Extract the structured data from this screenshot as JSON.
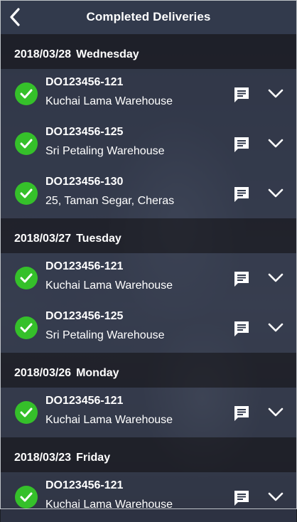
{
  "header": {
    "title": "Completed Deliveries"
  },
  "groups": [
    {
      "date": "2018/03/28",
      "day": "Wednesday",
      "items": [
        {
          "do_number": "DO123456-121",
          "location": "Kuchai Lama Warehouse"
        },
        {
          "do_number": "DO123456-125",
          "location": "Sri Petaling Warehouse"
        },
        {
          "do_number": "DO123456-130",
          "location": "25, Taman Segar, Cheras"
        }
      ]
    },
    {
      "date": "2018/03/27",
      "day": "Tuesday",
      "items": [
        {
          "do_number": "DO123456-121",
          "location": "Kuchai Lama Warehouse"
        },
        {
          "do_number": "DO123456-125",
          "location": "Sri Petaling Warehouse"
        }
      ]
    },
    {
      "date": "2018/03/26",
      "day": "Monday",
      "items": [
        {
          "do_number": "DO123456-121",
          "location": "Kuchai Lama Warehouse"
        }
      ]
    },
    {
      "date": "2018/03/23",
      "day": "Friday",
      "items": [
        {
          "do_number": "DO123456-121",
          "location": "Kuchai Lama Warehouse"
        }
      ]
    }
  ],
  "icons": {
    "back": "chevron-left-icon",
    "status": "check-circle-icon",
    "comment": "comment-icon",
    "expand": "chevron-down-icon"
  },
  "colors": {
    "header_bg": "#323a4c",
    "success": "#35c02a",
    "text": "#ffffff"
  }
}
